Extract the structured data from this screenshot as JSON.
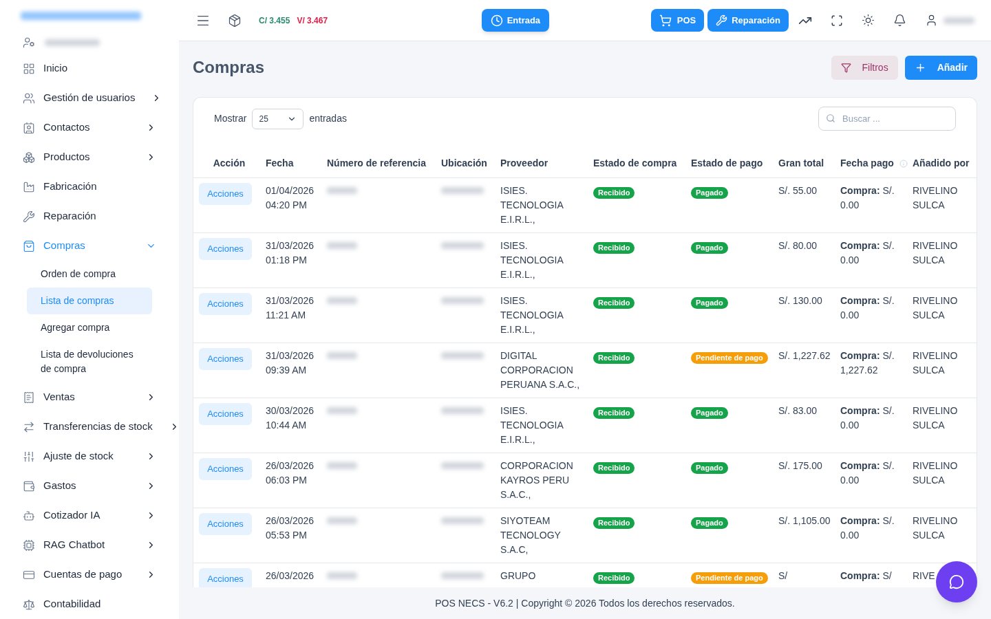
{
  "sidebar": {
    "items": [
      {
        "label": "Inicio",
        "selected": false
      },
      {
        "label": "Gestión de usuarios",
        "expanded": false,
        "selected": false
      },
      {
        "label": "Contactos",
        "expanded": false,
        "selected": false
      },
      {
        "label": "Productos",
        "expanded": false,
        "selected": false
      },
      {
        "label": "Fabricación",
        "selected": false
      },
      {
        "label": "Reparación",
        "selected": false
      },
      {
        "label": "Compras",
        "expanded": true,
        "selected": true,
        "children": [
          {
            "label": "Orden de compra",
            "selected": false
          },
          {
            "label": "Lista de compras",
            "selected": true
          },
          {
            "label": "Agregar compra",
            "selected": false
          },
          {
            "label": "Lista de devoluciones de compra",
            "selected": false
          }
        ]
      },
      {
        "label": "Ventas",
        "expanded": false,
        "selected": false
      },
      {
        "label": "Transferencias de stock",
        "expanded": false,
        "selected": false
      },
      {
        "label": "Ajuste de stock",
        "expanded": false,
        "selected": false
      },
      {
        "label": "Gastos",
        "expanded": false,
        "selected": false
      },
      {
        "label": "Cotizador IA",
        "expanded": false,
        "selected": false
      },
      {
        "label": "RAG Chatbot",
        "expanded": false,
        "selected": false
      },
      {
        "label": "Cuentas de pago",
        "expanded": false,
        "selected": false
      },
      {
        "label": "Contabilidad",
        "selected": false
      }
    ]
  },
  "header": {
    "buy_rate": "C/ 3.455",
    "sell_rate": "V/ 3.467",
    "entry_button": "Entrada",
    "pos_button": "POS",
    "repair_button": "Reparación"
  },
  "page": {
    "title": "Compras",
    "filter_button": "Filtros",
    "add_button": "Añadir"
  },
  "table": {
    "show_label": "Mostrar",
    "page_size": "25",
    "entries_label": "entradas",
    "search_placeholder": "Buscar ...",
    "columns": [
      "Acción",
      "Fecha",
      "Número de referencia",
      "Ubicación",
      "Proveedor",
      "Estado de compra",
      "Estado de pago",
      "Gran total",
      "Fecha pago",
      "Añadido por"
    ],
    "rows": [
      {
        "action": "Acciones",
        "date": "01/04/2026",
        "time": "04:20 PM",
        "supplier": "ISIES. TECNOLOGIA E.I.R.L.,",
        "purchase_status": {
          "text": "Recibido",
          "color": "#16a34a"
        },
        "payment_status": {
          "text": "Pagado",
          "color": "#16a34a"
        },
        "total": "S/. 55.00",
        "paid_label": "Compra:",
        "paid_value": "S/. 0.00",
        "added_by": "RIVELINO SULCA"
      },
      {
        "action": "Acciones",
        "date": "31/03/2026",
        "time": "01:18 PM",
        "supplier": "ISIES. TECNOLOGIA E.I.R.L.,",
        "purchase_status": {
          "text": "Recibido",
          "color": "#16a34a"
        },
        "payment_status": {
          "text": "Pagado",
          "color": "#16a34a"
        },
        "total": "S/. 80.00",
        "paid_label": "Compra:",
        "paid_value": "S/. 0.00",
        "added_by": "RIVELINO SULCA"
      },
      {
        "action": "Acciones",
        "date": "31/03/2026",
        "time": "11:21 AM",
        "supplier": "ISIES. TECNOLOGIA E.I.R.L.,",
        "purchase_status": {
          "text": "Recibido",
          "color": "#16a34a"
        },
        "payment_status": {
          "text": "Pagado",
          "color": "#16a34a"
        },
        "total": "S/. 130.00",
        "paid_label": "Compra:",
        "paid_value": "S/. 0.00",
        "added_by": "RIVELINO SULCA"
      },
      {
        "action": "Acciones",
        "date": "31/03/2026",
        "time": "09:39 AM",
        "supplier": "DIGITAL CORPORACION PERUANA S.A.C.,",
        "purchase_status": {
          "text": "Recibido",
          "color": "#16a34a"
        },
        "payment_status": {
          "text": "Pendiente de pago",
          "color": "#f59e0b"
        },
        "total": "S/. 1,227.62",
        "paid_label": "Compra:",
        "paid_value": "S/. 1,227.62",
        "added_by": "RIVELINO SULCA"
      },
      {
        "action": "Acciones",
        "date": "30/03/2026",
        "time": "10:44 AM",
        "supplier": "ISIES. TECNOLOGIA E.I.R.L.,",
        "purchase_status": {
          "text": "Recibido",
          "color": "#16a34a"
        },
        "payment_status": {
          "text": "Pagado",
          "color": "#16a34a"
        },
        "total": "S/. 83.00",
        "paid_label": "Compra:",
        "paid_value": "S/. 0.00",
        "added_by": "RIVELINO SULCA"
      },
      {
        "action": "Acciones",
        "date": "26/03/2026",
        "time": "06:03 PM",
        "supplier": "CORPORACION KAYROS PERU S.A.C.,",
        "purchase_status": {
          "text": "Recibido",
          "color": "#16a34a"
        },
        "payment_status": {
          "text": "Pagado",
          "color": "#16a34a"
        },
        "total": "S/. 175.00",
        "paid_label": "Compra:",
        "paid_value": "S/. 0.00",
        "added_by": "RIVELINO SULCA"
      },
      {
        "action": "Acciones",
        "date": "26/03/2026",
        "time": "05:53 PM",
        "supplier": "SIYOTEAM TECNOLOGY S.A.C,",
        "purchase_status": {
          "text": "Recibido",
          "color": "#16a34a"
        },
        "payment_status": {
          "text": "Pagado",
          "color": "#16a34a"
        },
        "total": "S/. 1,105.00",
        "paid_label": "Compra:",
        "paid_value": "S/. 0.00",
        "added_by": "RIVELINO SULCA"
      },
      {
        "action": "Acciones",
        "date": "26/03/2026",
        "supplier": "GRUPO",
        "purchase_status": {
          "text": "Recibido",
          "color": "#16a34a"
        },
        "payment_status": {
          "text": "Pendiente de pago",
          "color": "#f59e0b"
        },
        "total": "S/",
        "paid_label": "Compra:",
        "paid_value": "S/",
        "added_by": "RIVE"
      }
    ]
  },
  "footer": "POS NECS - V6.2 | Copyright © 2026 Todos los derechos reservados."
}
